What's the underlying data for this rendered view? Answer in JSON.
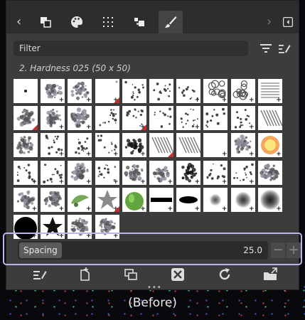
{
  "tabs": [
    {
      "icon": "layers-icon"
    },
    {
      "icon": "palette-icon"
    },
    {
      "icon": "grid-icon"
    },
    {
      "icon": "patterns-icon"
    },
    {
      "icon": "paintbrush-icon",
      "active": true
    }
  ],
  "filter": {
    "placeholder": "Filter"
  },
  "brush": {
    "name": "2. Hardness 025 (50 x 50)"
  },
  "spacing": {
    "label": "Spacing",
    "value": "25.0",
    "minus": "−",
    "plus": "+"
  },
  "toolbar_icons": [
    "edit-brush-icon",
    "new-brush-icon",
    "duplicate-brush-icon",
    "delete-brush-icon",
    "refresh-brushes-icon",
    "open-as-image-icon"
  ],
  "grip": "•••",
  "caption": "(Before)"
}
